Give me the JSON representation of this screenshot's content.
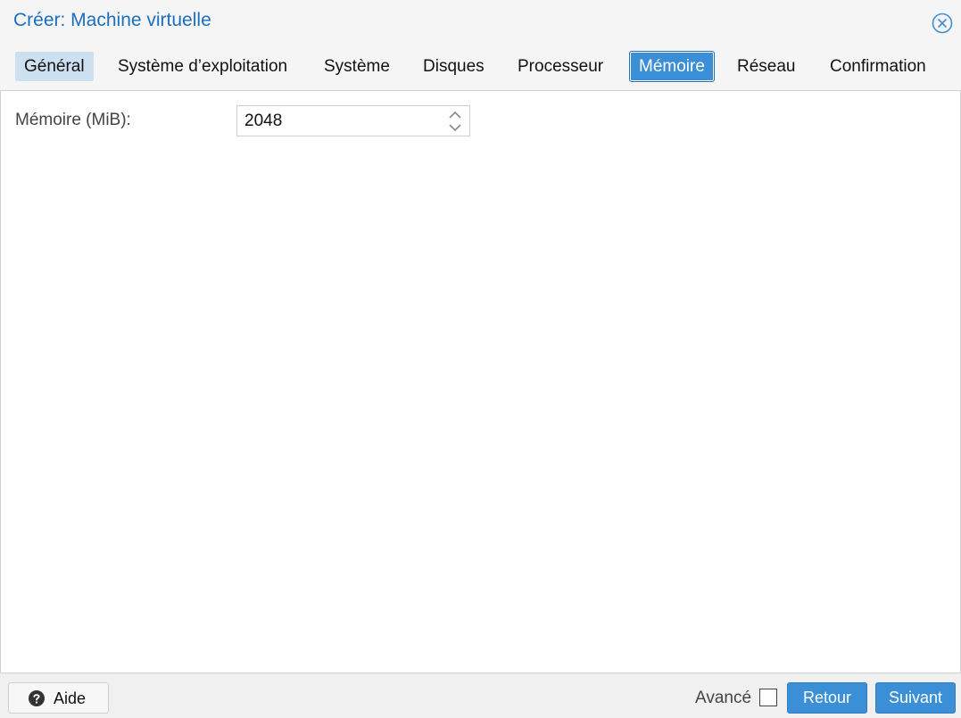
{
  "dialog": {
    "title": "Créer: Machine virtuelle"
  },
  "tabs": [
    {
      "label": "Général",
      "state": "visited"
    },
    {
      "label": "Système d’exploitation",
      "state": "normal"
    },
    {
      "label": "Système",
      "state": "normal"
    },
    {
      "label": "Disques",
      "state": "normal"
    },
    {
      "label": "Processeur",
      "state": "normal"
    },
    {
      "label": "Mémoire",
      "state": "active"
    },
    {
      "label": "Réseau",
      "state": "normal"
    },
    {
      "label": "Confirmation",
      "state": "normal"
    }
  ],
  "memory": {
    "label": "Mémoire (MiB):",
    "value": "2048"
  },
  "footer": {
    "help_label": "Aide",
    "advanced_label": "Avancé",
    "advanced_checked": false,
    "back_label": "Retour",
    "next_label": "Suivant"
  },
  "colors": {
    "accent": "#3a8fd6",
    "title": "#1b6fbf",
    "visited_tab": "#cde0f0"
  },
  "icons": {
    "close": "close-circle-icon",
    "help": "question-circle-icon",
    "spinner": "spinner-arrows-icon"
  }
}
